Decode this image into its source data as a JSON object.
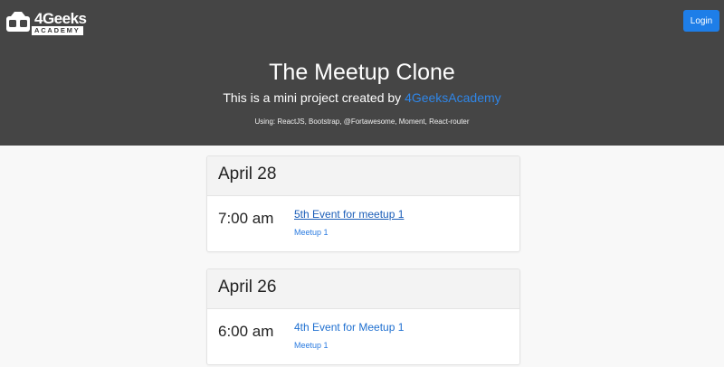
{
  "header": {
    "logo": {
      "brand": "4Geeks",
      "sub": "ACADEMY"
    },
    "login_label": "Login",
    "title": "The Meetup Clone",
    "subtitle_prefix": "This is a mini project created by ",
    "subtitle_link": "4GeeksAcademy",
    "tech": "Using: ReactJS, Bootstrap, @Fortawesome, Moment, React-router"
  },
  "events": [
    {
      "date": "April 28",
      "time": "7:00 am",
      "title": "5th Event for meetup 1",
      "meetup": "Meetup 1",
      "hovered": true
    },
    {
      "date": "April 26",
      "time": "6:00 am",
      "title": "4th Event for Meetup 1",
      "meetup": "Meetup 1",
      "hovered": false
    }
  ],
  "colors": {
    "hero_bg": "#454545",
    "accent": "#1e7ee8",
    "link": "#2f86e8",
    "page_bg": "#f8f8f8"
  }
}
